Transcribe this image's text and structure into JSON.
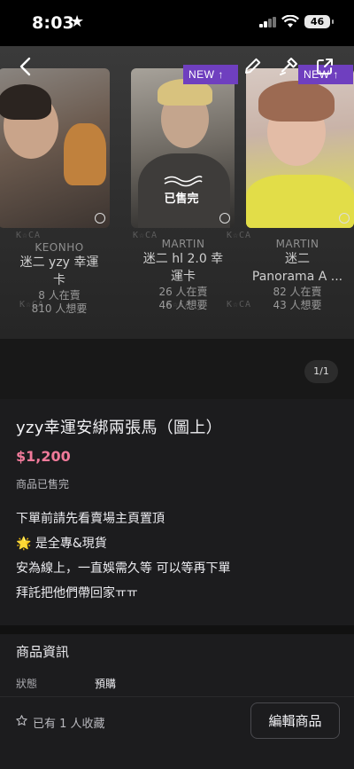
{
  "status_bar": {
    "time": "8:03",
    "battery": "46"
  },
  "gallery": {
    "pager": "1/1",
    "badge_new": "NEW ↑",
    "sold_out": "已售完",
    "watermark": "K☆CA",
    "cards": [
      {
        "name": "KEONHO",
        "title_line1": "迷二 yzy 幸運",
        "title_line2": "卡",
        "sellers": "8 人在賣",
        "wants": "810 人想要"
      },
      {
        "name": "MARTIN",
        "title_line1": "迷二 hl 2.0 幸",
        "title_line2": "運卡",
        "sellers": "26 人在賣",
        "wants": "46 人想要"
      },
      {
        "name": "MARTIN",
        "title_line1": "迷二",
        "title_line2": "Panorama A ...",
        "sellers": "82 人在賣",
        "wants": "43 人想要"
      }
    ]
  },
  "product": {
    "title": "yzy幸運安綁兩張馬（圖上）",
    "price": "$1,200",
    "status": "商品已售完",
    "description": [
      "下單前請先看賣場主頁置頂",
      "🌟 是全專&現貨",
      "安為線上，一直娛需久等 可以等再下單",
      "拜託把他們帶回家ㅠㅠ"
    ]
  },
  "info": {
    "heading": "商品資訊",
    "status_label": "狀態",
    "status_value": "預購"
  },
  "footer": {
    "favorites": "已有 1 人收藏",
    "edit_button": "編輯商品"
  },
  "colors": {
    "price": "#f07a9a",
    "badge": "#6f3fbf",
    "panel": "#1c1c1e"
  }
}
